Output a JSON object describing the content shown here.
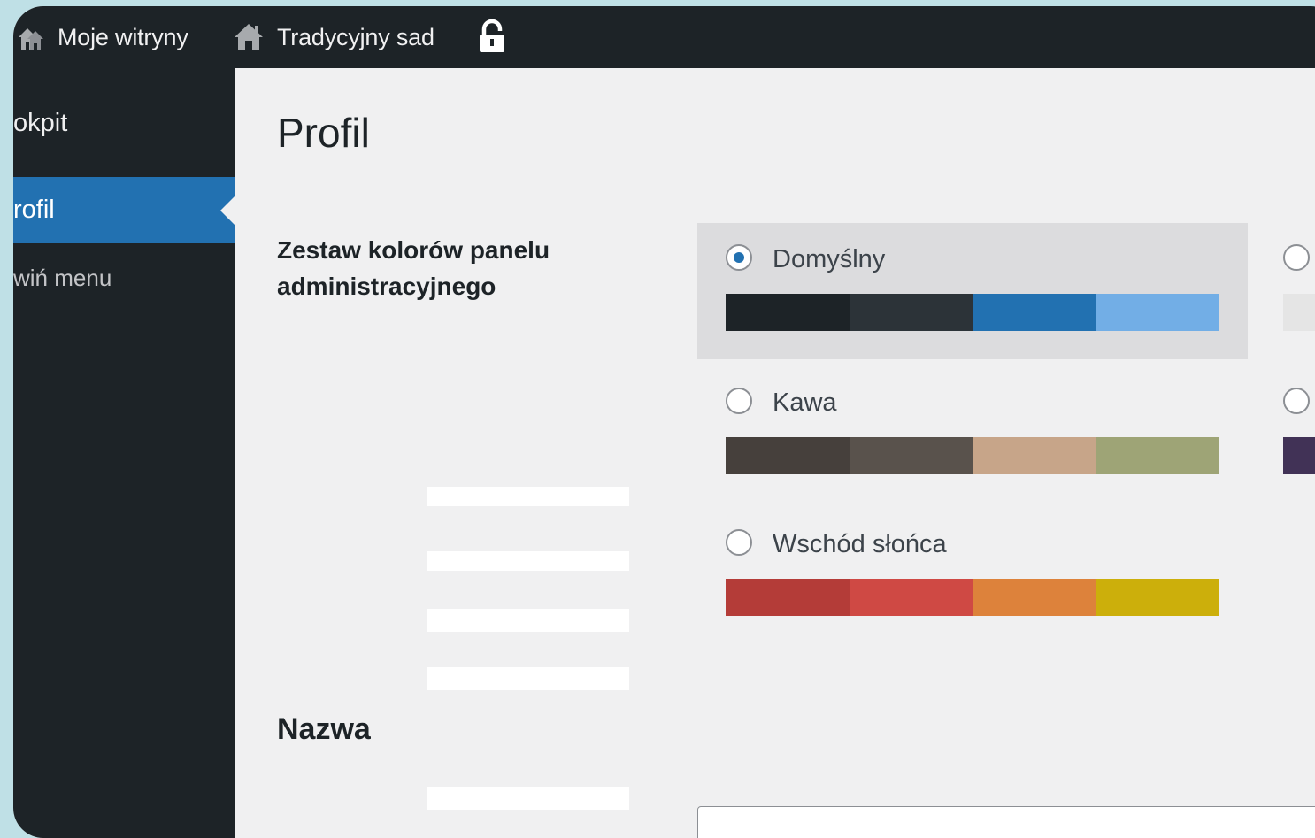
{
  "adminbar": {
    "my_sites_label": "Moje witryny",
    "site_name": "Tradycyjny sad"
  },
  "sidebar": {
    "items": [
      {
        "label": "okpit",
        "active": false
      },
      {
        "label": "rofil",
        "active": true
      },
      {
        "label": "wiń menu",
        "active": false
      }
    ]
  },
  "main": {
    "page_title": "Profil",
    "color_scheme_label_line1": "Zestaw kolorów panelu",
    "color_scheme_label_line2": "administracyjnego",
    "name_heading": "Nazwa",
    "schemes": [
      {
        "name": "Domyślny",
        "selected": true,
        "colors": [
          "#1d2327",
          "#2c3338",
          "#2271b1",
          "#72aee6"
        ]
      },
      {
        "name": "Kawa",
        "selected": false,
        "colors": [
          "#46403c",
          "#59524c",
          "#c7a589",
          "#9ea476"
        ]
      },
      {
        "name": "Wschód słońca",
        "selected": false,
        "colors": [
          "#b43c38",
          "#cf4944",
          "#dd823b",
          "#ccaf0b"
        ]
      }
    ],
    "partial_schemes": [
      {
        "selected": false,
        "first_color": "#e5e5e5"
      },
      {
        "selected": false,
        "first_color": "#413256"
      }
    ]
  }
}
